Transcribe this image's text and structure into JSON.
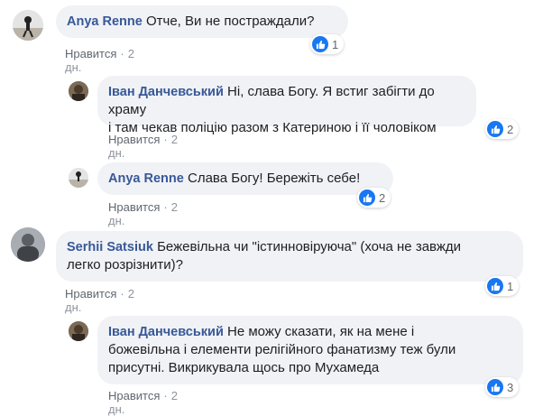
{
  "comments": [
    {
      "author": "Anya Renne",
      "text": "Отче, Ви не постраждали?",
      "like_label": "Нравится",
      "time": "2 дн.",
      "reactions": "1"
    },
    {
      "author": "Іван Данчевський",
      "text_line1": "Ні, слава Богу. Я встиг забігти до храму",
      "text_line2": "і там чекав поліцію разом з Катериною і її чоловіком",
      "like_label": "Нравится",
      "time": "2 дн.",
      "reactions": "2"
    },
    {
      "author": "Anya Renne",
      "text": "Слава Богу! Бережіть себе!",
      "like_label": "Нравится",
      "time": "2 дн.",
      "reactions": "2"
    },
    {
      "author": "Serhii Satsiuk",
      "text_line1": "Бежевільна чи \"істинновіруюча\" (хоча не завжди",
      "text_line2": "легко розрізнити)?",
      "like_label": "Нравится",
      "time": "2 дн.",
      "reactions": "1"
    },
    {
      "author": "Іван Данчевський",
      "text_line1": "Не можу сказати, як на мене і",
      "text_line2": "божевільна і елементи релігійного фанатизму теж були",
      "text_line3": "присутні. Викрикувала щось про Мухамеда",
      "like_label": "Нравится",
      "time": "2 дн.",
      "reactions": "3"
    }
  ],
  "separator": "·",
  "reaction_icon": "thumbs-up-icon",
  "colors": {
    "author": "#385898",
    "bubble": "#f0f2f5",
    "like_badge": "#1877f2"
  }
}
